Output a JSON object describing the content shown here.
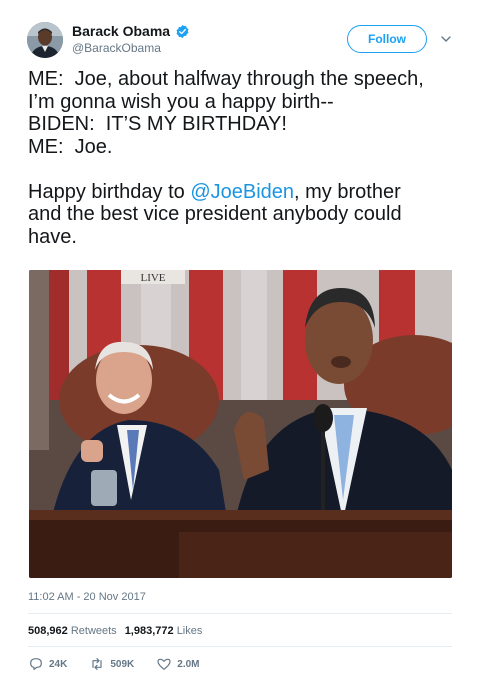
{
  "author": {
    "name": "Barack Obama",
    "handle": "@BarackObama"
  },
  "follow_label": "Follow",
  "tweet": {
    "line1": "ME:  Joe, about halfway through the speech,",
    "line2": "I’m gonna wish you a happy birth--",
    "line3": "BIDEN:  IT’S MY BIRTHDAY!",
    "line4": "ME:  Joe.",
    "line5_prefix": "Happy birthday to ",
    "mention": "@JoeBiden",
    "line5_suffix": ", my brother",
    "line6": "and the best vice president anybody could",
    "line7": "have."
  },
  "media": {
    "sign_text": "LIVE"
  },
  "timestamp": "11:02 AM - 20 Nov 2017",
  "stats": {
    "retweets_count": "508,962",
    "retweets_label": "Retweets",
    "likes_count": "1,983,772",
    "likes_label": "Likes"
  },
  "actions": {
    "reply": "24K",
    "retweet": "509K",
    "like": "2.0M"
  },
  "colors": {
    "accent": "#1da1f2",
    "text": "#14171a",
    "muted": "#657786"
  }
}
